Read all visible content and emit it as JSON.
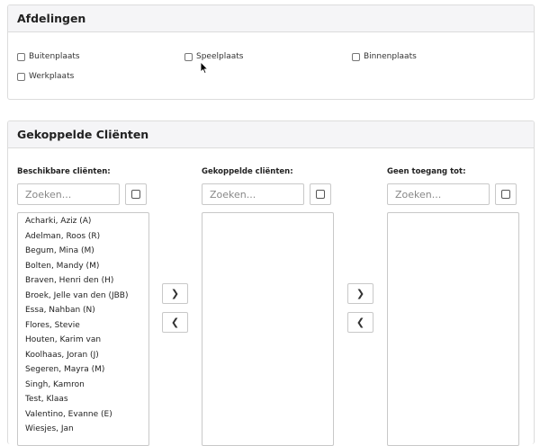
{
  "departments": {
    "title": "Afdelingen",
    "options": [
      {
        "label": "Buitenplaats",
        "checked": false
      },
      {
        "label": "Speelplaats",
        "checked": false
      },
      {
        "label": "Binnenplaats",
        "checked": false
      },
      {
        "label": "Werkplaats",
        "checked": false
      }
    ]
  },
  "clients": {
    "title": "Gekoppelde Cliënten",
    "available": {
      "label": "Beschikbare cliënten:",
      "search_placeholder": "Zoeken...",
      "items": [
        "Acharki, Aziz (A)",
        "Adelman, Roos (R)",
        "Begum, Mina (M)",
        "Bolten, Mandy (M)",
        "Braven, Henri den (H)",
        "Broek, Jelle van den (JBB)",
        "Essa, Nahban (N)",
        "Flores, Stevie",
        "Houten, Karim van",
        "Koolhaas, Joran (J)",
        "Segeren, Mayra (M)",
        "Singh, Kamron",
        "Test, Klaas",
        "Valentino, Evanne (E)",
        "Wiesjes, Jan"
      ]
    },
    "linked": {
      "label": "Gekoppelde cliënten:",
      "search_placeholder": "Zoeken...",
      "items": []
    },
    "no_access": {
      "label": "Geen toegang tot:",
      "search_placeholder": "Zoeken...",
      "items": []
    },
    "move_right_icon": "chevron-right-icon",
    "move_left_icon": "chevron-left-icon",
    "select_all_icon": "checkbox-square-icon"
  }
}
